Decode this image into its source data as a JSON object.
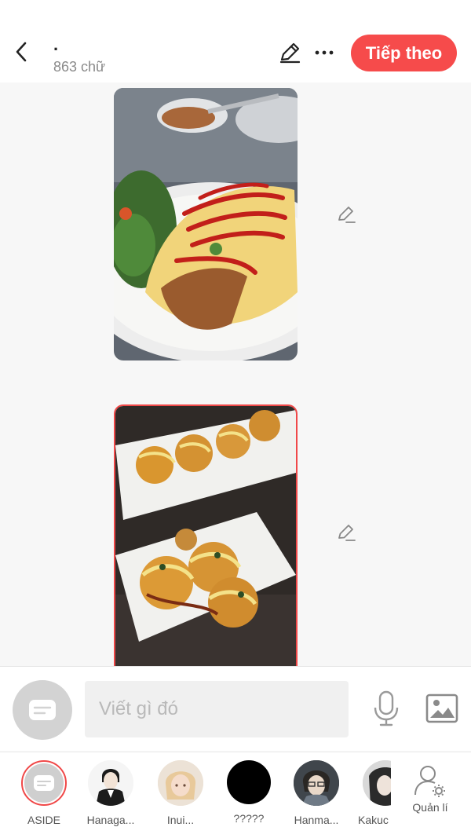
{
  "header": {
    "title": ".",
    "word_count": "863 chữ",
    "next_label": "Tiếp theo"
  },
  "content": {
    "images": [
      {
        "alt": "omurice-image"
      },
      {
        "alt": "takoyaki-image"
      }
    ]
  },
  "composer": {
    "placeholder": "Viết gì đó"
  },
  "characters": [
    {
      "name": "ASIDE"
    },
    {
      "name": "Hanaga..."
    },
    {
      "name": "Inui..."
    },
    {
      "name": "?????"
    },
    {
      "name": "Hanma..."
    },
    {
      "name": "Kakuc"
    }
  ],
  "manage_label": "Quản lí",
  "colors": {
    "accent": "#f64b4b",
    "background": "#f7f7f7"
  }
}
